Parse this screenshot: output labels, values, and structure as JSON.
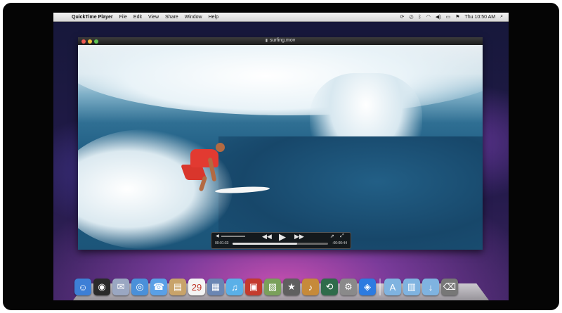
{
  "menubar": {
    "apple": "",
    "app_name": "QuickTime Player",
    "menus": [
      "File",
      "Edit",
      "View",
      "Share",
      "Window",
      "Help"
    ],
    "clock": "Thu 10:50 AM",
    "status_icons": [
      "sync-icon",
      "timemachine-icon",
      "bluetooth-icon",
      "wifi-icon",
      "volume-icon",
      "battery-icon",
      "flag-icon",
      "spotlight-icon"
    ]
  },
  "player": {
    "title": "surfing.mov",
    "elapsed": "00:01:33",
    "remaining": "-00:00:44",
    "progress": 0.68
  },
  "dock": {
    "items": [
      {
        "name": "finder",
        "icon": "☺",
        "color": "#3d7fd6"
      },
      {
        "name": "dashboard",
        "icon": "◉",
        "color": "#2a2a2a"
      },
      {
        "name": "mail",
        "icon": "✉",
        "color": "#9aa7c2"
      },
      {
        "name": "safari",
        "icon": "◎",
        "color": "#4a90d9"
      },
      {
        "name": "ichat",
        "icon": "☎",
        "color": "#5aa0e6"
      },
      {
        "name": "address-book",
        "icon": "▤",
        "color": "#c8a36a"
      },
      {
        "name": "ical",
        "icon": "29",
        "color": "#f4f4f4"
      },
      {
        "name": "preview",
        "icon": "▦",
        "color": "#6b86b3"
      },
      {
        "name": "itunes",
        "icon": "♫",
        "color": "#5ab0e8"
      },
      {
        "name": "photo-booth",
        "icon": "▣",
        "color": "#c43b2e"
      },
      {
        "name": "iphoto",
        "icon": "▨",
        "color": "#7aa05a"
      },
      {
        "name": "imovie",
        "icon": "★",
        "color": "#5f5f5f"
      },
      {
        "name": "garageband",
        "icon": "♪",
        "color": "#c68a3a"
      },
      {
        "name": "time-machine",
        "icon": "⟲",
        "color": "#2f6b4a"
      },
      {
        "name": "system-preferences",
        "icon": "⚙",
        "color": "#8a8a8a"
      },
      {
        "name": "app-store",
        "icon": "◈",
        "color": "#2d7be0"
      },
      {
        "name": "applications-folder",
        "icon": "A",
        "color": "#7fb3e0"
      },
      {
        "name": "documents-folder",
        "icon": "▥",
        "color": "#7fb3e0"
      },
      {
        "name": "downloads-folder",
        "icon": "↓",
        "color": "#7fb3e0"
      },
      {
        "name": "trash",
        "icon": "⌫",
        "color": "#777777"
      }
    ]
  }
}
